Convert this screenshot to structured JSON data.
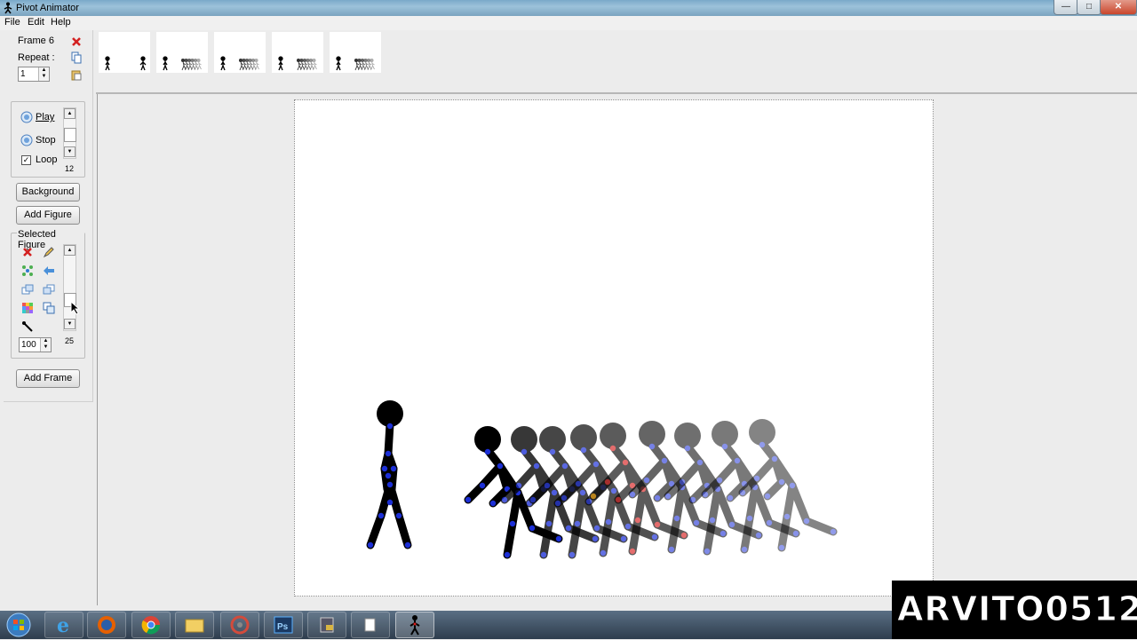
{
  "window": {
    "title": "Pivot Animator"
  },
  "menu": [
    {
      "label": "File"
    },
    {
      "label": "Edit"
    },
    {
      "label": "Help"
    }
  ],
  "frame_info": {
    "label": "Frame 6",
    "repeat_label": "Repeat :",
    "repeat_value": "1"
  },
  "playback": {
    "play": "Play",
    "stop": "Stop",
    "loop": "Loop",
    "loop_checked": true,
    "speed_value": "12"
  },
  "buttons": {
    "background": "Background",
    "add_figure": "Add Figure",
    "add_frame": "Add Frame"
  },
  "selected_figure": {
    "title": "Selected Figure",
    "size_value": "100",
    "slider_value": "25"
  },
  "timeline": {
    "frame_count": 5
  },
  "watermark": "ARVITO0512",
  "taskbar": {
    "icons": [
      "windows-start-icon",
      "internet-explorer-icon",
      "firefox-icon",
      "chrome-icon",
      "file-explorer-icon",
      "media-player-icon",
      "photoshop-icon",
      "app-icon",
      "notepad-icon",
      "pivot-animator-icon"
    ],
    "photoshop_label": "Ps"
  },
  "colors": {
    "joint_blue": "#1c2fd6",
    "joint_red": "#d61c1c",
    "joint_orange": "#f5a300",
    "figure": "#000000"
  }
}
